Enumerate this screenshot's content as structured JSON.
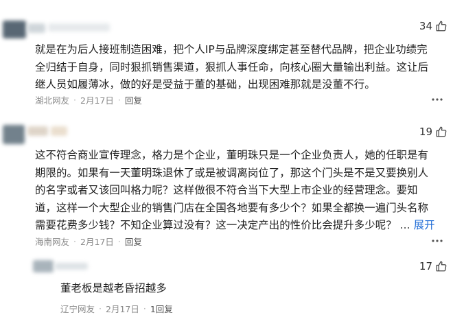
{
  "comments": [
    {
      "likes": "34",
      "lines": [
        "就是在为后人接班制造困难，把个人IP与品牌深度绑定甚至替代品牌，把企业功绩完",
        "全归结于自身，同时狠抓销售渠道，狠抓人事任命，向核心圈大量输出利益。这让后",
        "继人员如履薄冰，做的好是受益于董的基础，出现困难那就是没董不行。"
      ],
      "location": "湖北网友",
      "date": "2月17日",
      "reply": "回复",
      "dot": "·"
    },
    {
      "likes": "19",
      "lines": [
        "这不符合商业宣传理念，格力是个企业，董明珠只是一个企业负责人，她的任职是有",
        "期限的。如果有一天董明珠退休了或是被调离岗位了，那这个门头是不是又要换别人",
        "的名字或者又该回叫格力呢？这样做很不符合当下大型上市企业的经营理念。要知",
        "道，这样一个大型企业的销售门店在全国各地要有多少个？如果全都换一遍门头名称",
        "需要花费多少钱？不知企业算过没有？这一决定产出的性价比会提升多少呢？"
      ],
      "ellipsis": "...",
      "expand": "展开",
      "location": "海南网友",
      "date": "2月17日",
      "reply": "回复",
      "dot": "·"
    },
    {
      "likes": "17",
      "lines": [
        "董老板是越老昏招越多"
      ],
      "location": "辽宁网友",
      "date": "2月17日",
      "reply": "1回复",
      "dot": "·"
    }
  ],
  "more_icon": "more-dots-icon",
  "like_icon": "thumbs-up-icon",
  "colors": {
    "expand": "#1e6bd6",
    "meta": "#8a8a8a",
    "text": "#1f1f1f"
  }
}
